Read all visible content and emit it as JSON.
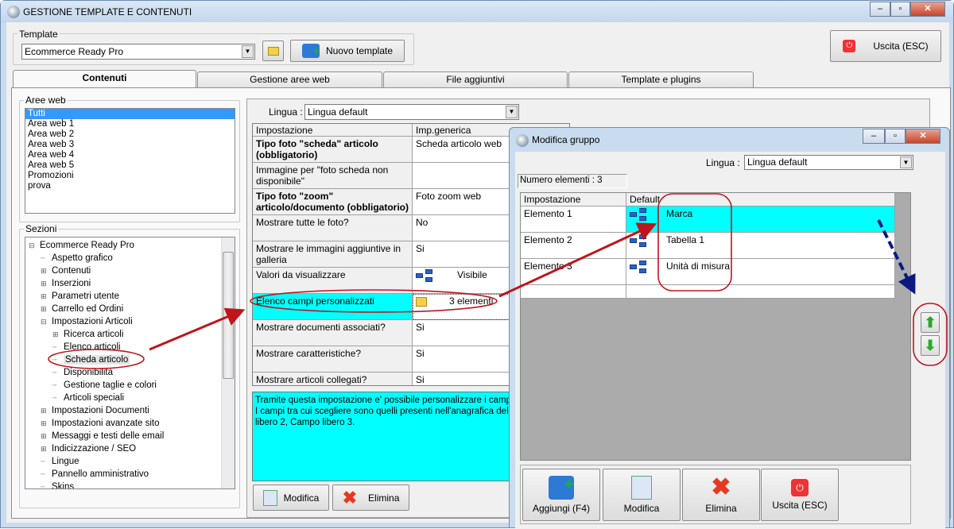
{
  "window": {
    "title": "GESTIONE TEMPLATE E CONTENUTI",
    "controls": [
      "minimize",
      "maximize",
      "close"
    ]
  },
  "template": {
    "group_label": "Template",
    "selected": "Ecommerce Ready Pro",
    "new_button": "Nuovo template",
    "exit_button": "Uscita (ESC)"
  },
  "tabs": [
    {
      "label": "Contenuti",
      "active": true
    },
    {
      "label": "Gestione aree web"
    },
    {
      "label": "File aggiuntivi"
    },
    {
      "label": "Template e plugins"
    }
  ],
  "aree_web": {
    "label": "Aree web",
    "items": [
      "Tutti",
      "Area web 1",
      "Area web 2",
      "Area web 3",
      "Area web 4",
      "Area web 5",
      "Promozioni",
      "prova"
    ],
    "selected": "Tutti"
  },
  "sezioni": {
    "label": "Sezioni",
    "items": [
      {
        "label": "Ecommerce Ready Pro",
        "level": 0,
        "exp": "-"
      },
      {
        "label": "Aspetto grafico",
        "level": 1,
        "exp": ""
      },
      {
        "label": "Contenuti",
        "level": 1,
        "exp": "+"
      },
      {
        "label": "Inserzioni",
        "level": 1,
        "exp": "+"
      },
      {
        "label": "Parametri utente",
        "level": 1,
        "exp": "+"
      },
      {
        "label": "Carrello ed Ordini",
        "level": 1,
        "exp": "+"
      },
      {
        "label": "Impostazioni Articoli",
        "level": 1,
        "exp": "-"
      },
      {
        "label": "Ricerca articoli",
        "level": 2,
        "exp": "+"
      },
      {
        "label": "Elenco articoli",
        "level": 2,
        "exp": ""
      },
      {
        "label": "Scheda articolo",
        "level": 2,
        "exp": "",
        "selected": true
      },
      {
        "label": "Disponibilità",
        "level": 2,
        "exp": ""
      },
      {
        "label": "Gestione taglie e colori",
        "level": 2,
        "exp": ""
      },
      {
        "label": "Articoli speciali",
        "level": 2,
        "exp": ""
      },
      {
        "label": "Impostazioni Documenti",
        "level": 1,
        "exp": "+"
      },
      {
        "label": "Impostazioni avanzate sito",
        "level": 1,
        "exp": "+"
      },
      {
        "label": "Messaggi e testi delle email",
        "level": 1,
        "exp": "+"
      },
      {
        "label": "Indicizzazione / SEO",
        "level": 1,
        "exp": "+"
      },
      {
        "label": "Lingue",
        "level": 1,
        "exp": ""
      },
      {
        "label": "Pannello amministrativo",
        "level": 1,
        "exp": ""
      },
      {
        "label": "Skins",
        "level": 1,
        "exp": ""
      }
    ]
  },
  "settings": {
    "lingua_label": "Lingua :",
    "lingua": "Lingua default",
    "headers": [
      "Impostazione",
      "Imp.generica"
    ],
    "rows": [
      {
        "k": "Tipo foto \"scheda\" articolo (obbligatorio)",
        "v": "Scheda articolo web",
        "bold": true
      },
      {
        "k": "Immagine per \"foto scheda non disponibile\"",
        "v": ""
      },
      {
        "k": "Tipo foto \"zoom\" articolo/documento (obbligatorio)",
        "v": "Foto zoom web",
        "bold": true
      },
      {
        "k": "Mostrare tutte le foto?",
        "v": "No"
      },
      {
        "k": "Mostrare le immagini aggiuntive in galleria",
        "v": "Si"
      },
      {
        "k": "Valori da visualizzare",
        "v": "Visibile",
        "icon": "tree-icon"
      },
      {
        "k": "Elenco campi personalizzati",
        "v": "3 elementi",
        "icon": "folder-icon",
        "selected": true
      },
      {
        "k": "Mostrare documenti associati?",
        "v": "Si"
      },
      {
        "k": "Mostrare caratteristiche?",
        "v": "Si"
      },
      {
        "k": "Mostrare articoli collegati?",
        "v": "Si"
      }
    ],
    "description": "Tramite questa impostazione e' possibile personalizzare i campi vis\nI campi tra cui scegliere sono quelli presenti nell'anagrafica dell'artic\nlibero 2, Campo libero 3.",
    "modify_button": "Modifica",
    "delete_button": "Elimina"
  },
  "dialog": {
    "title": "Modifica gruppo",
    "lingua_label": "Lingua :",
    "lingua": "Lingua default",
    "count_label": "Numero elementi : 3",
    "headers": [
      "Impostazione",
      "Default"
    ],
    "rows": [
      {
        "k": "Elemento 1",
        "v": "Marca",
        "selected": true
      },
      {
        "k": "Elemento 2",
        "v": "Tabella 1"
      },
      {
        "k": "Elemento 3",
        "v": "Unità di misura"
      }
    ],
    "buttons": [
      "Aggiungi (F4)",
      "Modifica",
      "Elimina",
      "Uscita (ESC)"
    ]
  },
  "colors": {
    "selection": "#00ffff",
    "annotation": "#c0141c",
    "arrow_blue": "#0a1a80"
  }
}
